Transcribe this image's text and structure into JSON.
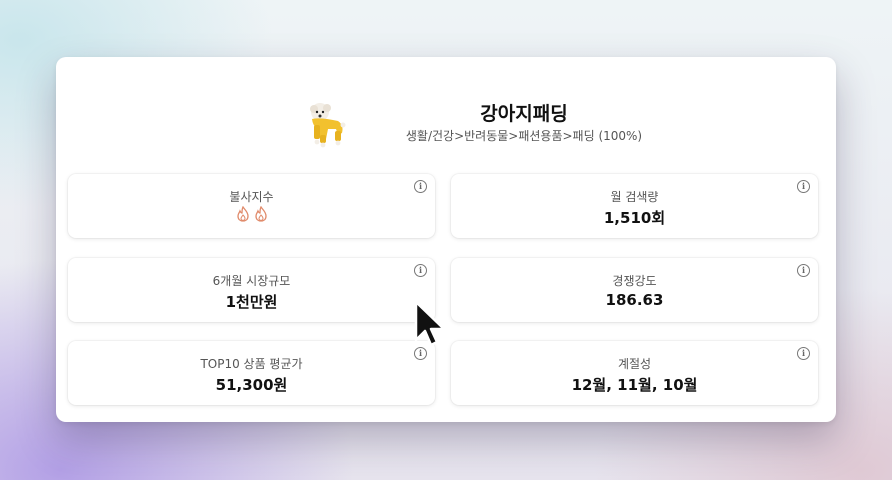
{
  "product": {
    "title": "강아지패딩",
    "category": "생활/건강>반려동물>패션용품>패딩 (100%)"
  },
  "metrics": [
    {
      "label": "불사지수",
      "value": "",
      "icon": "fire-icon",
      "count": 2
    },
    {
      "label": "월 검색량",
      "value": "1,510회"
    },
    {
      "label": "6개월 시장규모",
      "value": "1천만원"
    },
    {
      "label": "경쟁강도",
      "value": "186.63"
    },
    {
      "label": "TOP10 상품 평균가",
      "value": "51,300원"
    },
    {
      "label": "계절성",
      "value": "12월, 11월, 10월"
    }
  ],
  "info_icon_glyph": "i",
  "colors": {
    "fire": "#e08a6a",
    "product_yellow": "#f2c12e"
  }
}
